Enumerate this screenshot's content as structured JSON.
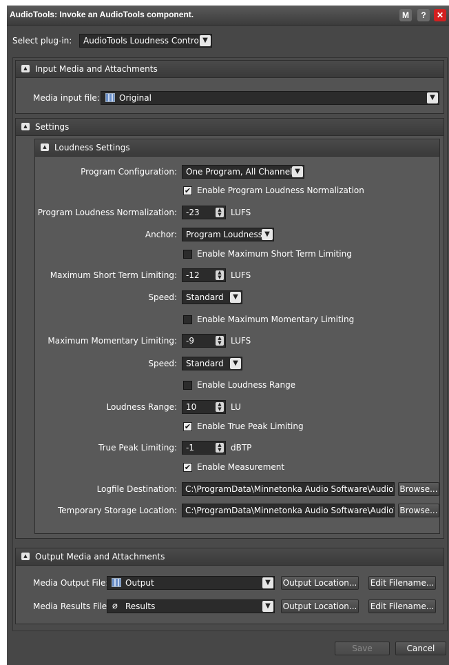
{
  "window": {
    "title": "AudioTools: Invoke an AudioTools component.",
    "buttons": {
      "m": "M",
      "help": "?",
      "close": "✕"
    }
  },
  "plugin": {
    "label": "Select plug-in:",
    "value": "AudioTools Loudness Control"
  },
  "input_panel": {
    "header": "Input Media and Attachments",
    "media_input_label": "Media input file:",
    "media_input_value": "Original"
  },
  "settings_panel": {
    "header": "Settings",
    "loudness": {
      "header": "Loudness Settings",
      "program_config_label": "Program Configuration:",
      "program_config_value": "One Program, All Channels",
      "enable_normalization": {
        "label": "Enable Program Loudness Normalization",
        "checked": true
      },
      "normalization_label": "Program Loudness Normalization:",
      "normalization_value": "-23",
      "normalization_unit": "LUFS",
      "anchor_label": "Anchor:",
      "anchor_value": "Program Loudness",
      "enable_short_term": {
        "label": "Enable Maximum Short Term Limiting",
        "checked": false
      },
      "short_term_label": "Maximum Short Term Limiting:",
      "short_term_value": "-12",
      "short_term_unit": "LUFS",
      "speed1_label": "Speed:",
      "speed1_value": "Standard",
      "enable_momentary": {
        "label": "Enable Maximum Momentary Limiting",
        "checked": false
      },
      "momentary_label": "Maximum Momentary Limiting:",
      "momentary_value": "-9",
      "momentary_unit": "LUFS",
      "speed2_label": "Speed:",
      "speed2_value": "Standard",
      "enable_range": {
        "label": "Enable Loudness Range",
        "checked": false
      },
      "range_label": "Loudness Range:",
      "range_value": "10",
      "range_unit": "LU",
      "enable_true_peak": {
        "label": "Enable True Peak Limiting",
        "checked": true
      },
      "true_peak_label": "True Peak Limiting:",
      "true_peak_value": "-1",
      "true_peak_unit": "dBTP",
      "enable_measurement": {
        "label": "Enable Measurement",
        "checked": true
      },
      "logfile_label": "Logfile Destination:",
      "logfile_value": "C:\\ProgramData\\Minnetonka Audio Software\\AudioT",
      "temp_label": "Temporary Storage Location:",
      "temp_value": "C:\\ProgramData\\Minnetonka Audio Software\\AudioT",
      "browse_label": "Browse..."
    }
  },
  "output_panel": {
    "header": "Output Media and Attachments",
    "media_output_label": "Media Output File:",
    "media_output_value": "Output",
    "media_results_label": "Media Results File:",
    "media_results_value": "Results",
    "output_location_label": "Output Location...",
    "edit_filename_label": "Edit Filename..."
  },
  "footer": {
    "save_label": "Save",
    "cancel_label": "Cancel"
  },
  "icons": {
    "film": "film-strip-icon",
    "paperclip": "paperclip-icon",
    "chevron": "chevron-down-icon",
    "spinner": "spinner-arrows-icon",
    "collapse": "collapse-arrow-icon"
  }
}
